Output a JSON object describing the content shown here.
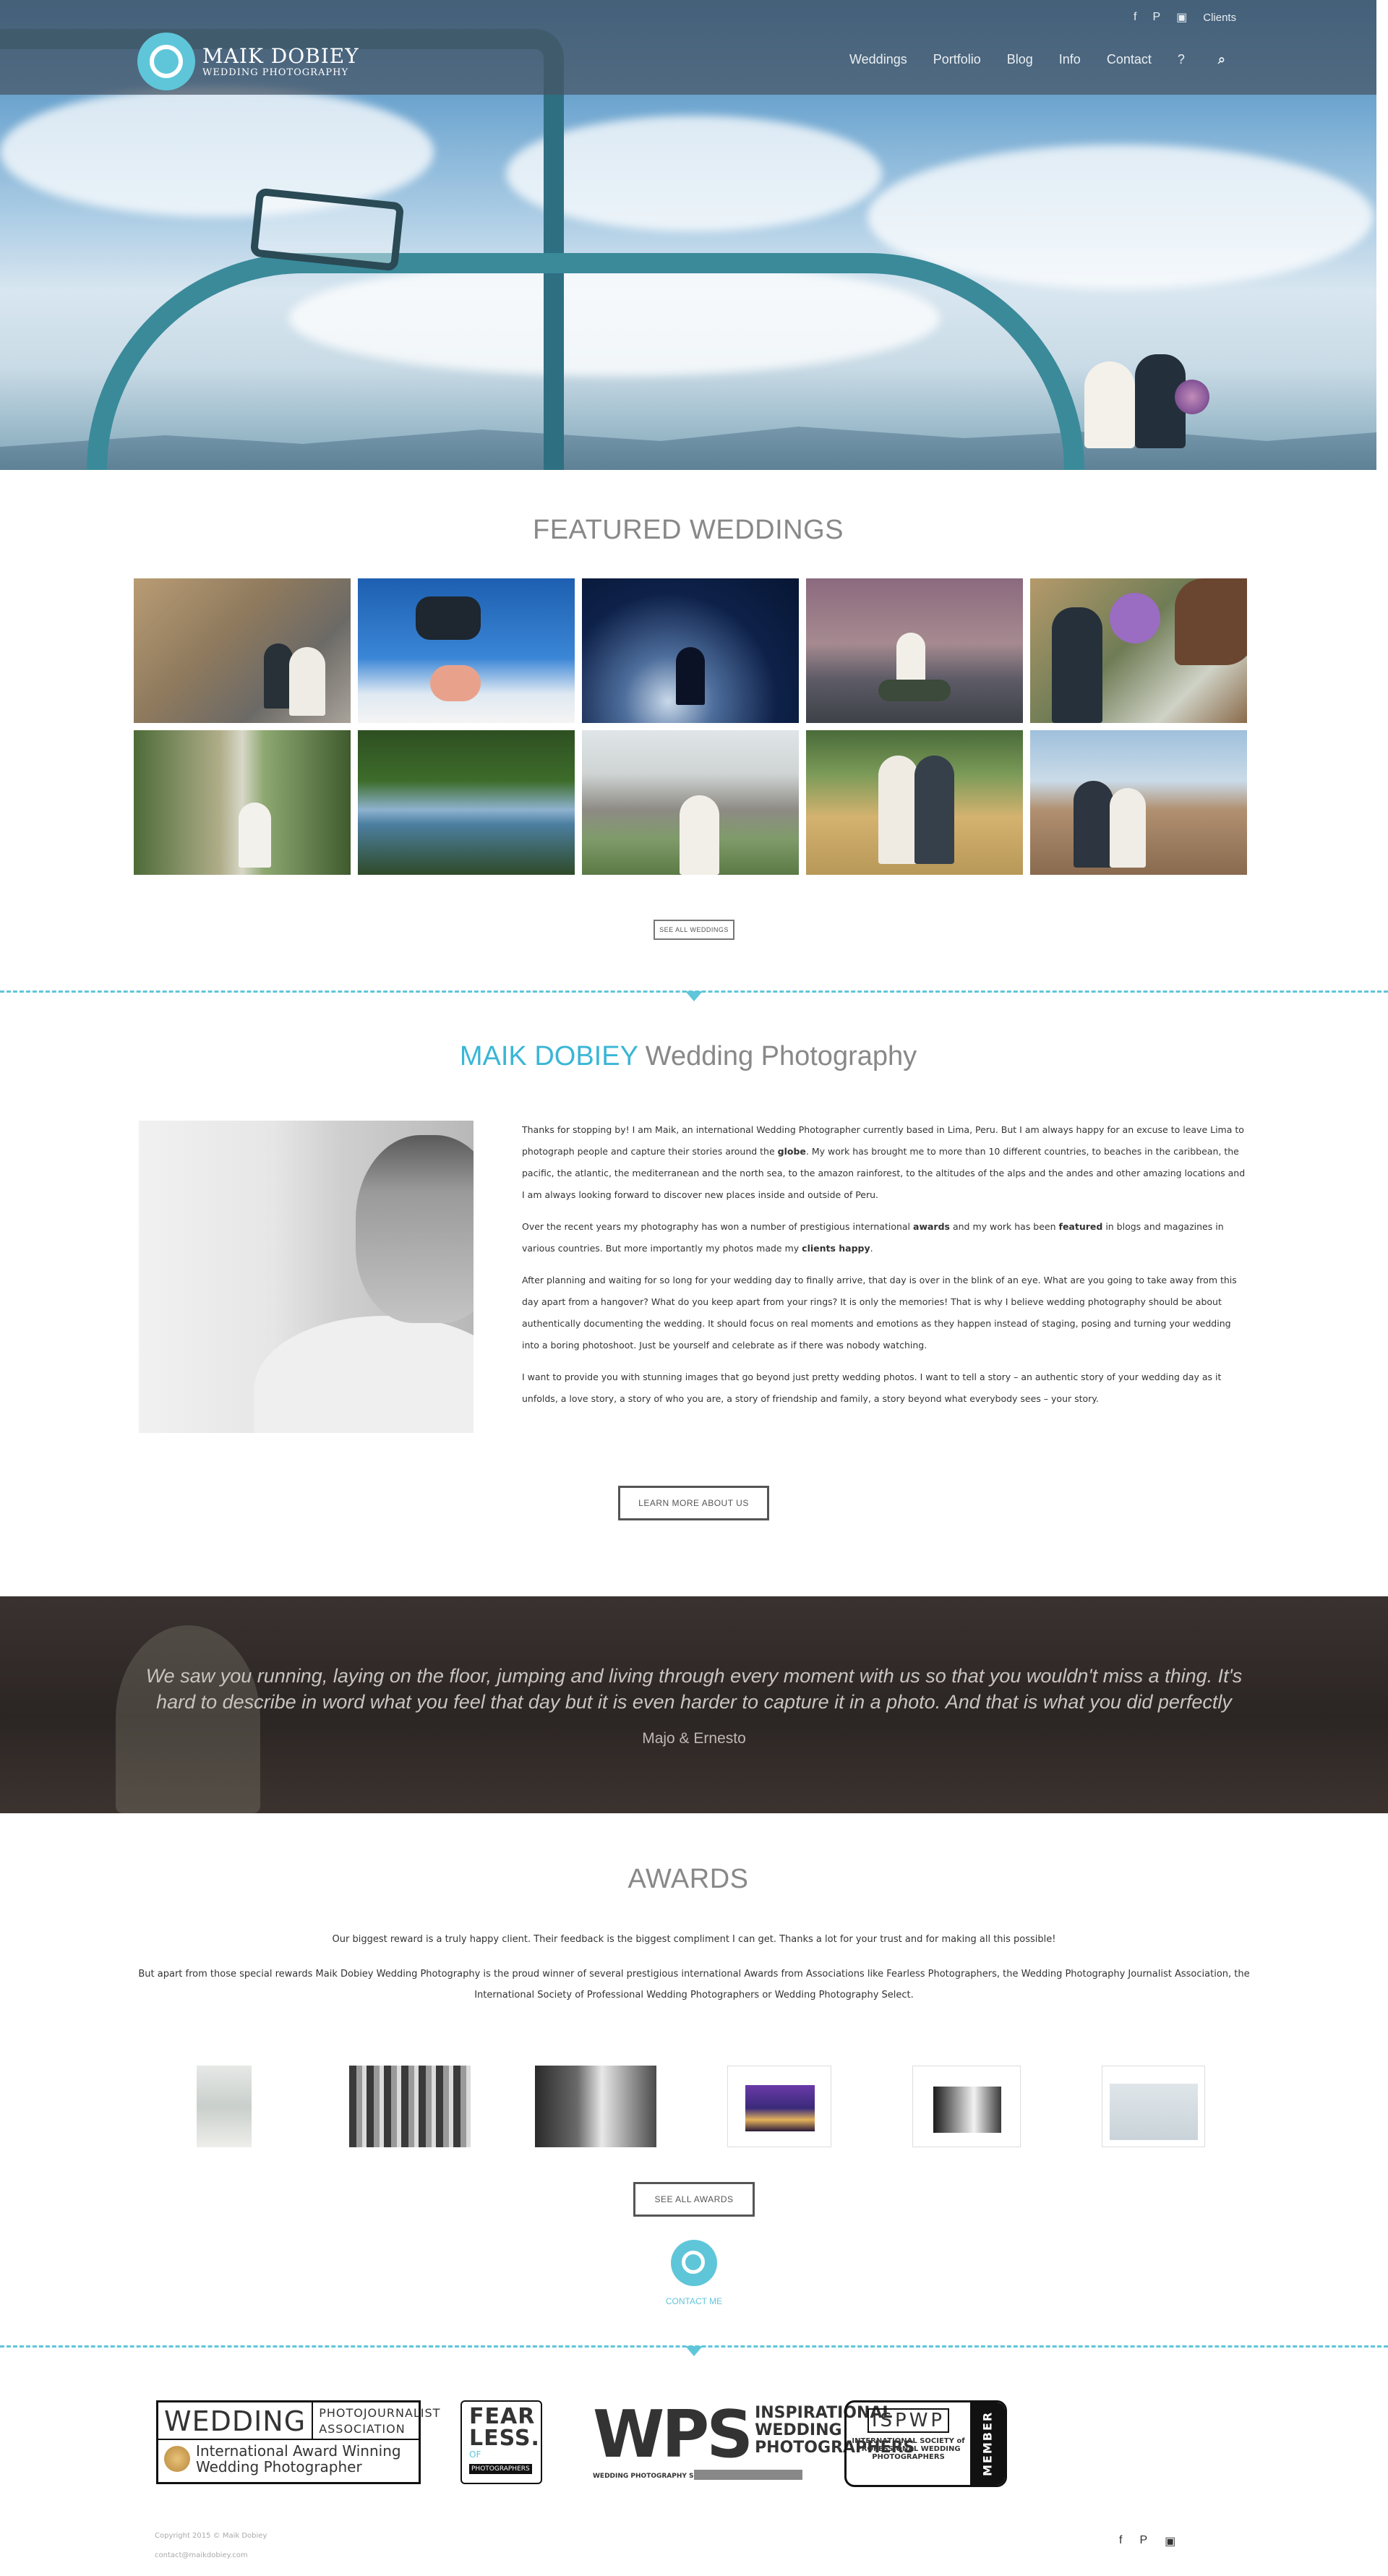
{
  "header": {
    "logo_name": "MAIK DOBIEY",
    "logo_tagline": "WEDDING PHOTOGRAPHY",
    "social": [
      {
        "icon": "facebook-icon",
        "glyph": "f"
      },
      {
        "icon": "pinterest-icon",
        "glyph": "P"
      },
      {
        "icon": "instagram-icon",
        "glyph": "▣"
      }
    ],
    "clients_label": "Clients",
    "nav": [
      "Weddings",
      "Portfolio",
      "Blog",
      "Info",
      "Contact",
      "?"
    ],
    "search_icon": "⌕"
  },
  "featured": {
    "title": "FEATURED WEDDINGS",
    "see_all": "SEE ALL WEDDINGS"
  },
  "about": {
    "title_brand": "MAIK DOBIEY",
    "title_rest": " Wedding Photography",
    "p1_a": "Thanks for stopping by! I am Maik, an international Wedding Photographer currently based in Lima, Peru. But I am always happy for an excuse to leave Lima to photograph people and capture their stories around the ",
    "p1_bold": "globe",
    "p1_b": ". My work has brought me to more than 10 different countries, to beaches in the caribbean, the pacific, the atlantic, the mediterranean and the north sea, to the amazon rainforest, to the altitudes of the alps and the andes and other amazing locations and I am always looking forward to discover new places inside and outside of Peru.",
    "p2_a": "Over the recent years my photography has won a number of prestigious international ",
    "p2_bold1": "awards",
    "p2_b": " and my work has been ",
    "p2_bold2": "featured",
    "p2_c": " in blogs and magazines in various countries. But more importantly my photos made my ",
    "p2_bold3": "clients happy",
    "p2_d": ".",
    "p3": "After planning and waiting for so long for your wedding day to finally arrive, that day is over in the blink of an eye. What are you going to take away from this day apart from a hangover? What do you keep apart from your rings? It is only the memories! That is why I believe wedding photography should be about authentically documenting the wedding. It should focus on real moments and emotions as they happen instead of staging, posing and turning your wedding into a boring photoshoot. Just be yourself and celebrate as if there was nobody watching.",
    "p4": "I want to provide you with stunning images that go beyond just pretty wedding photos. I want to tell a story – an authentic story of your wedding day as it unfolds, a love story, a story of who you are, a story of friendship and family, a story beyond what everybody sees – your story.",
    "button": "LEARN MORE ABOUT US"
  },
  "testimonial": {
    "quote": "We saw you running, laying on the floor, jumping and living through every moment with us so that you wouldn't miss a thing. It's hard to describe in word what you feel that day but it is even harder to capture it in a photo. And that is what you did perfectly",
    "author": "Majo & Ernesto"
  },
  "awards": {
    "title": "AWARDS",
    "p1": "Our biggest reward is a truly happy client. Their feedback is the biggest compliment I can get. Thanks a lot for your trust and for making all this possible!",
    "p2": "But apart from those special rewards Maik Dobiey Wedding Photography is the proud winner of several prestigious international Awards from Associations like Fearless Photographers, the Wedding Photography Journalist Association, the International Society of Professional Wedding Photographers or Wedding Photography Select.",
    "button": "SEE ALL AWARDS",
    "contact": "CONTACT ME"
  },
  "badges": {
    "wpja_word": "WEDDING",
    "wpja_side": "PHOTOJOURNALIST ASSOCIATION",
    "wpja_award": "International Award Winning Wedding Photographer",
    "fear_title": "FEAR LESS.",
    "fear_of": "OF",
    "fear_sub": "PHOTOGRAPHERS",
    "wps_big": "WPS",
    "wps_side": "INSPIRATIONAL WEDDING PHOTOGRAPHERS",
    "wps_sub": "WEDDING PHOTOGRAPHY SELECT",
    "ispwp_title": "ISPWP",
    "ispwp_desc": "INTERNATIONAL SOCIETY of PROFESSIONAL WEDDING PHOTOGRAPHERS",
    "ispwp_member": "MEMBER"
  },
  "footer": {
    "copyright": "Copyright 2015 © Maik Dobiey",
    "email": "contact@maikdobiey.com",
    "social": [
      "f",
      "P",
      "▣"
    ]
  },
  "colors": {
    "accent": "#5fc6d9",
    "brand_title": "#3ab6d6"
  }
}
